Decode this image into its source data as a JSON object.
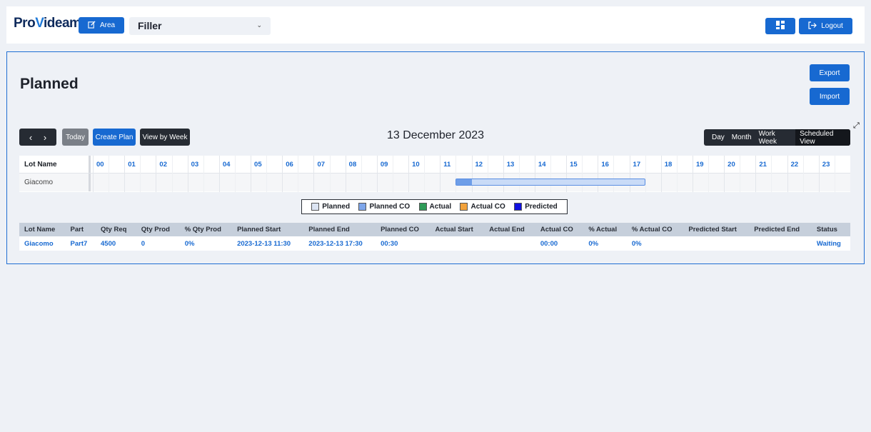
{
  "header": {
    "logo_pre": "Pro",
    "logo_v": "V",
    "logo_post": "ideam",
    "area_label": "Area",
    "selected_area": "Filler",
    "logout_label": "Logout"
  },
  "page": {
    "title": "Planned",
    "export_label": "Export",
    "import_label": "Import"
  },
  "toolbar": {
    "prev": "‹",
    "next": "›",
    "today_label": "Today",
    "create_plan_label": "Create Plan",
    "view_by_week_label": "View by Week",
    "date_title": "13 December 2023",
    "views": [
      "Day",
      "Month",
      "Work Week",
      "Scheduled View"
    ],
    "active_view": "Scheduled View"
  },
  "gantt": {
    "lot_header": "Lot Name",
    "hours": [
      "00",
      "01",
      "02",
      "03",
      "04",
      "05",
      "06",
      "07",
      "08",
      "09",
      "10",
      "11",
      "12",
      "13",
      "14",
      "15",
      "16",
      "17",
      "18",
      "19",
      "20",
      "21",
      "22",
      "23"
    ],
    "rows": [
      {
        "lot": "Giacomo",
        "planned_start": "11:30",
        "co_end": "12:00",
        "planned_end": "17:30"
      }
    ]
  },
  "legend": {
    "items": [
      {
        "label": "Planned",
        "color": "#dce4f2"
      },
      {
        "label": "Planned CO",
        "color": "#7ea6ea"
      },
      {
        "label": "Actual",
        "color": "#2e9b57"
      },
      {
        "label": "Actual CO",
        "color": "#f3a23a"
      },
      {
        "label": "Predicted",
        "color": "#1111e0"
      }
    ]
  },
  "table": {
    "columns": [
      "Lot Name",
      "Part",
      "Qty Req",
      "Qty Prod",
      "% Qty Prod",
      "Planned Start",
      "Planned End",
      "Planned CO",
      "Actual Start",
      "Actual End",
      "Actual CO",
      "% Actual",
      "% Actual CO",
      "Predicted Start",
      "Predicted End",
      "Status"
    ],
    "rows": [
      [
        "Giacomo",
        "Part7",
        "4500",
        "0",
        "0%",
        "2023-12-13 11:30",
        "2023-12-13 17:30",
        "00:30",
        "",
        "",
        "00:00",
        "0%",
        "0%",
        "",
        "",
        "Waiting"
      ]
    ]
  },
  "colors": {
    "accent": "#1769d1",
    "dark": "#262b33",
    "panel_border": "#1f6ed3"
  }
}
